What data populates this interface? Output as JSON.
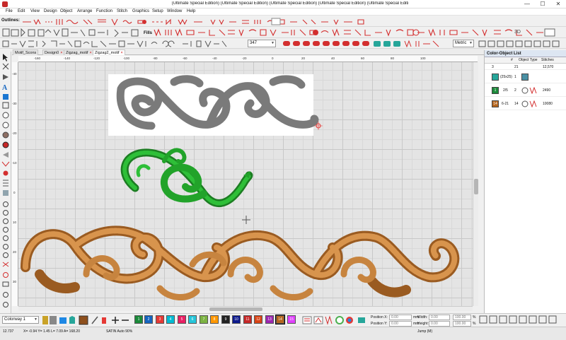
{
  "window": {
    "title": "(Ultimate Special Edition) (Ultimate Special Edition) (Ultimate Special Edition) (Ultimate Special Edition) (Ultimate Special Editi",
    "minimize": "—",
    "maximize": "☐",
    "close": "✕"
  },
  "menu": [
    "File",
    "Edit",
    "View",
    "Design",
    "Object",
    "Arrange",
    "Function",
    "Stitch",
    "Graphics",
    "Setup",
    "Window",
    "Help"
  ],
  "toolbar": {
    "outlines_label": "Outlines:",
    "fills_label": "Fills",
    "angle_value": "347",
    "units_value": "Metric",
    "view_3d": "3D"
  },
  "tabs": [
    {
      "label": "Motif_Scons"
    },
    {
      "label": "Design0"
    },
    {
      "label": "Zigzag_motif"
    },
    {
      "label": "Zigzag2_motif"
    }
  ],
  "ruler": {
    "top": [
      "-160",
      "-140",
      "-120",
      "-100",
      "-80",
      "-60",
      "-40",
      "-20",
      "0",
      "20",
      "40",
      "60",
      "80",
      "100"
    ],
    "left": [
      "-40",
      "-30",
      "-20",
      "-10",
      "0",
      "10",
      "20",
      "30",
      "40",
      "50"
    ]
  },
  "panel": {
    "title": "Color-Object List",
    "headers": [
      "#",
      "Object Type",
      "Stitches"
    ],
    "rows": [
      {
        "cols": "3",
        "num": "21",
        "stitches": "12,570",
        "color": "#2e7d32"
      },
      {
        "range": "(25x25)",
        "num": "1",
        "stitches": "",
        "color": "#26a69a"
      },
      {
        "range": "2/5",
        "num": "2",
        "stitches": "2490",
        "color": "#2e7d32"
      },
      {
        "range": "6-21",
        "num": "14",
        "stitches": "10080",
        "color": "#b5651d"
      }
    ]
  },
  "bottom": {
    "colorway": "Colorway 1",
    "chips": [
      {
        "num": "1",
        "color": "#1b8a3a"
      },
      {
        "num": "2",
        "color": "#1565c0"
      },
      {
        "num": "3",
        "color": "#e53935"
      },
      {
        "num": "4",
        "color": "#00bcd4"
      },
      {
        "num": "5",
        "color": "#e91e63"
      },
      {
        "num": "6",
        "color": "#26c6da"
      },
      {
        "num": "7",
        "color": "#7cb342"
      },
      {
        "num": "8",
        "color": "#ff9800"
      },
      {
        "num": "9",
        "color": "#222222"
      },
      {
        "num": "10",
        "color": "#0d1a8c"
      },
      {
        "num": "11",
        "color": "#c62828"
      },
      {
        "num": "12",
        "color": "#d84315"
      },
      {
        "num": "13",
        "color": "#9c27b0"
      },
      {
        "num": "14",
        "color": "#b5651d"
      },
      {
        "num": "15",
        "color": "#e040fb"
      }
    ],
    "position_x_label": "Position X:",
    "position_y_label": "Position Y:",
    "width_label": "Width:",
    "height_label": "Height:",
    "position_x": "0.00",
    "position_y": "0.00",
    "width": "0.00",
    "height": "0.00",
    "pct1": "100.00",
    "pct2": "100.00",
    "unit": "mm",
    "pct": "%"
  },
  "status": {
    "coords": "12.737",
    "x": "X= -0.94 Y= 1.45 L= 7.09 A= 168.20",
    "mode": "SATIN Auto 90%",
    "jump": "Jump (M)"
  },
  "colors": {
    "gray_motif": "#7a7a7a",
    "green_motif": "#22a32a",
    "brown_motif": "#c7843f",
    "accent": "#d32f2f"
  }
}
